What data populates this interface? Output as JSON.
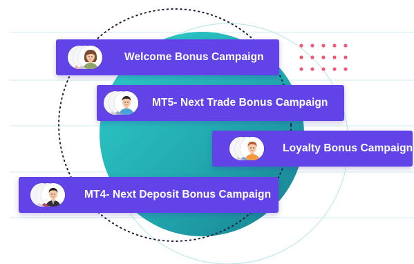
{
  "colors": {
    "card_background": "#6243e8",
    "teal_circle_start": "#2ec7c4",
    "teal_circle_end": "#1a8c97",
    "dot_accent": "#ef5a78",
    "guide_lines": "#c8ecec",
    "dotted_ring": "#1d1d3a"
  },
  "campaigns": [
    {
      "label": "Welcome Bonus Campaign",
      "front_avatar": "woman-avatar-icon"
    },
    {
      "label": "MT5- Next Trade Bonus Campaign",
      "front_avatar": "man-avatar-icon"
    },
    {
      "label": "Loyalty Bonus Campaign",
      "front_avatar": "woman-avatar-icon"
    },
    {
      "label": "MT4- Next Deposit Bonus Campaign",
      "front_avatar": "businessman-avatar-icon"
    }
  ]
}
